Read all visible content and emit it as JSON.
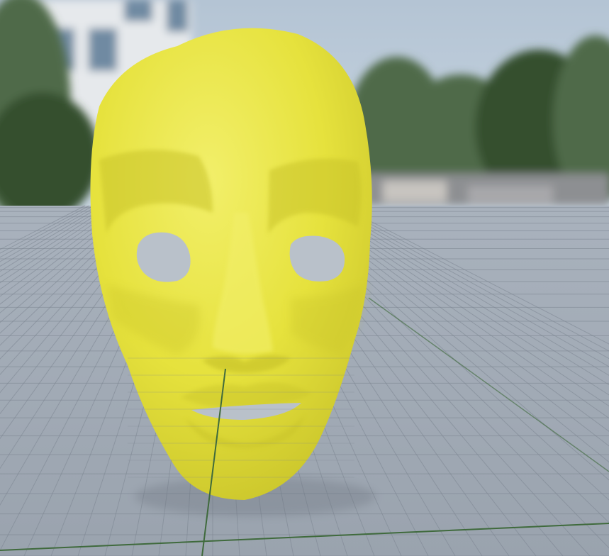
{
  "viewport": {
    "kind": "3d-render-preview",
    "subject": "mask-mesh",
    "colors": {
      "sky": "#c9d6e2",
      "sky_top": "#b4c4d4",
      "foliage": "#4f6a48",
      "foliage_dark": "#36502f",
      "building": "#e6e9ec",
      "floor": "#9aa3ae",
      "floor_far": "#a9b2bd",
      "grid_line": "#7c8591",
      "grid_axis": "#3f6a3c",
      "mask": "#e6e23d",
      "mask_shade": "#c9c42a",
      "mask_highlight": "#f2ef6a",
      "hole": "#b9c1ca"
    },
    "show_grid": true,
    "icons": []
  }
}
